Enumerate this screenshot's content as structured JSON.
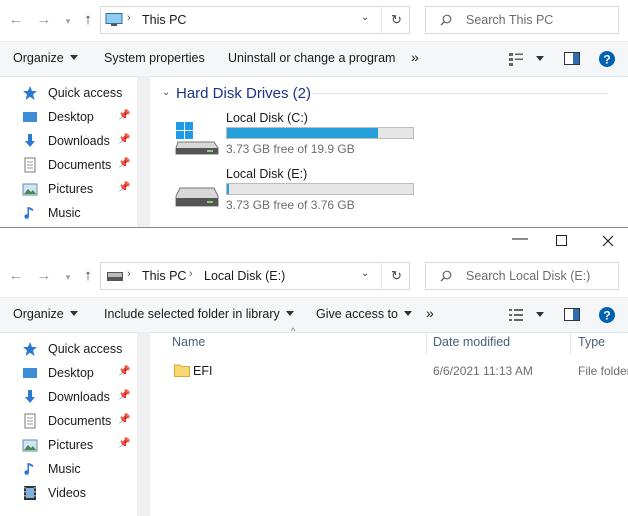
{
  "window1": {
    "address": {
      "location": "This PC"
    },
    "search_placeholder": "Search This PC",
    "toolbar": {
      "organize": "Organize",
      "system_properties": "System properties",
      "uninstall": "Uninstall or change a program",
      "more": "»"
    },
    "nav": [
      {
        "label": "Quick access",
        "icon": "star-icon"
      },
      {
        "label": "Desktop",
        "icon": "desktop-icon"
      },
      {
        "label": "Downloads",
        "icon": "download-icon"
      },
      {
        "label": "Documents",
        "icon": "documents-icon"
      },
      {
        "label": "Pictures",
        "icon": "pictures-icon"
      },
      {
        "label": "Music",
        "icon": "music-icon"
      }
    ],
    "section": "Hard Disk Drives (2)",
    "drives": [
      {
        "name": "Local Disk (C:)",
        "free": "3.73 GB free of 19.9 GB",
        "used_fraction": 0.81,
        "bar_color": "#26a0da"
      },
      {
        "name": "Local Disk (E:)",
        "free": "3.73 GB free of 3.76 GB",
        "used_fraction": 0.01,
        "bar_color": "#26a0da"
      }
    ]
  },
  "window2": {
    "address": {
      "crumb1": "This PC",
      "crumb2": "Local Disk (E:)"
    },
    "search_placeholder": "Search Local Disk (E:)",
    "toolbar": {
      "organize": "Organize",
      "include": "Include selected folder in library",
      "give_access": "Give access to",
      "more": "»"
    },
    "nav": [
      {
        "label": "Quick access",
        "icon": "star-icon"
      },
      {
        "label": "Desktop",
        "icon": "desktop-icon"
      },
      {
        "label": "Downloads",
        "icon": "download-icon"
      },
      {
        "label": "Documents",
        "icon": "documents-icon"
      },
      {
        "label": "Pictures",
        "icon": "pictures-icon"
      },
      {
        "label": "Music",
        "icon": "music-icon"
      },
      {
        "label": "Videos",
        "icon": "videos-icon"
      }
    ],
    "columns": {
      "name": "Name",
      "date": "Date modified",
      "type": "Type"
    },
    "files": [
      {
        "name": "EFI",
        "date": "6/6/2021 11:13 AM",
        "type": "File folder"
      }
    ]
  },
  "colors": {
    "accent": "#26a0da",
    "section_title": "#1e3287",
    "help": "#0063b1"
  }
}
